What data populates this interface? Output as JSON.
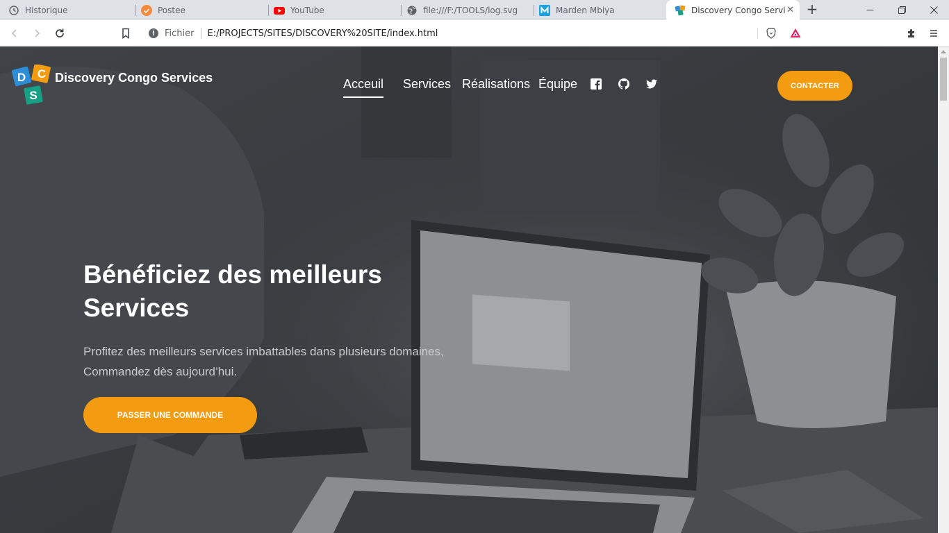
{
  "browser": {
    "tabs": [
      {
        "label": "Historique",
        "icon": "history-icon"
      },
      {
        "label": "Postee",
        "icon": "postee-icon"
      },
      {
        "label": "YouTube",
        "icon": "youtube-icon"
      },
      {
        "label": "file:///F:/TOOLS/log.svg",
        "icon": "globe-icon"
      },
      {
        "label": "Marden Mbiya",
        "icon": "m-logo-icon"
      },
      {
        "label": "Discovery Congo Services",
        "icon": "dcs-favicon-icon",
        "active": true
      }
    ],
    "new_tab": "+",
    "address": {
      "scheme_label": "Fichier",
      "url": "E:/PROJECTS/SITES/DISCOVERY%20SITE/index.html"
    },
    "colors": {
      "accent": "#f39c12",
      "tab_bg": "#dee1e6"
    }
  },
  "site": {
    "logo": {
      "letters": [
        "D",
        "C",
        "S"
      ],
      "name": "Discovery Congo Services",
      "colors": [
        "#2c8ed6",
        "#f39c12",
        "#16a085"
      ]
    },
    "nav": [
      {
        "label": "Acceuil",
        "active": true
      },
      {
        "label": "Services"
      },
      {
        "label": "Réalisations"
      },
      {
        "label": "Équipe"
      }
    ],
    "social": [
      "facebook-icon",
      "github-icon",
      "twitter-icon"
    ],
    "contact_label": "CONTACTER",
    "hero": {
      "title_line1": "Bénéficiez des meilleurs",
      "title_line2": "Services",
      "subtitle_line1": "Profitez des meilleurs services imbattables dans plusieurs domaines,",
      "subtitle_line2": "Commandez dès aujourd’hui.",
      "cta_label": "PASSER UNE COMMANDE"
    }
  }
}
